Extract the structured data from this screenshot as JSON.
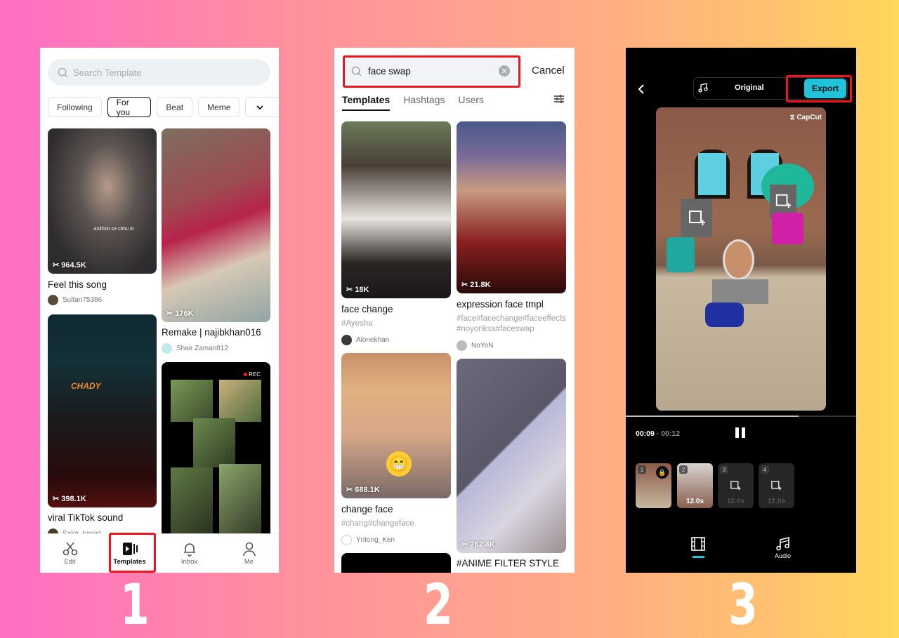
{
  "steps": [
    "1",
    "2",
    "3"
  ],
  "screen1": {
    "search_placeholder": "Search Template",
    "chips": [
      "Following",
      "For you",
      "Beat",
      "Meme"
    ],
    "active_chip": "For you",
    "cards": [
      {
        "count": "964.5K",
        "title": "Feel this song",
        "author": "Sultan75386",
        "overlay_text": "Ankhon se chhu lo"
      },
      {
        "count": "176K",
        "title": "Remake | najibkhan016",
        "author": "Shair Zaman812"
      },
      {
        "count": "398.1K",
        "title": "viral TikTok sound",
        "author": "Saka_tumist",
        "overlay_text": "CHADY"
      },
      {
        "overlay_text": "REC"
      }
    ],
    "nav": [
      {
        "label": "Edit",
        "icon": "scissors-icon"
      },
      {
        "label": "Templates",
        "icon": "templates-icon",
        "active": true
      },
      {
        "label": "Inbox",
        "icon": "bell-icon"
      },
      {
        "label": "Me",
        "icon": "person-icon"
      }
    ]
  },
  "screen2": {
    "search_value": "face swap",
    "cancel_label": "Cancel",
    "tabs": [
      "Templates",
      "Hashtags",
      "Users"
    ],
    "active_tab": "Templates",
    "cards": [
      {
        "count": "18K",
        "title": "face change",
        "tags": "#Ayesha",
        "author": "Alonekhan"
      },
      {
        "count": "21.8K",
        "title": "expression face tmpl",
        "tags": "#face#facechange#faceeffects#noyonksa#faceswap",
        "author": "NoYoN"
      },
      {
        "count": "688.1K",
        "title": "change face",
        "tags": "#chang#changeface",
        "author": "Yntong_Ken"
      },
      {
        "count": "762.4K",
        "title": "#ANIME FILTER STYLE"
      }
    ]
  },
  "screen3": {
    "music_label": "Original",
    "export_label": "Export",
    "watermark": "CapCut",
    "current_time": "00:09",
    "total_time": "00:12",
    "progress": 0.75,
    "clips": [
      {
        "num": "1",
        "locked": true
      },
      {
        "num": "2",
        "duration": "12.0s"
      },
      {
        "num": "3",
        "duration": "12.0s",
        "empty": true
      },
      {
        "num": "4",
        "duration": "12.0s",
        "empty": true
      }
    ],
    "bottom_tabs": [
      {
        "label": "",
        "icon": "film-icon",
        "active": true
      },
      {
        "label": "Audio",
        "icon": "music-icon"
      }
    ]
  },
  "colors": {
    "accent": "#21c3db",
    "highlight": "#f0141e"
  }
}
